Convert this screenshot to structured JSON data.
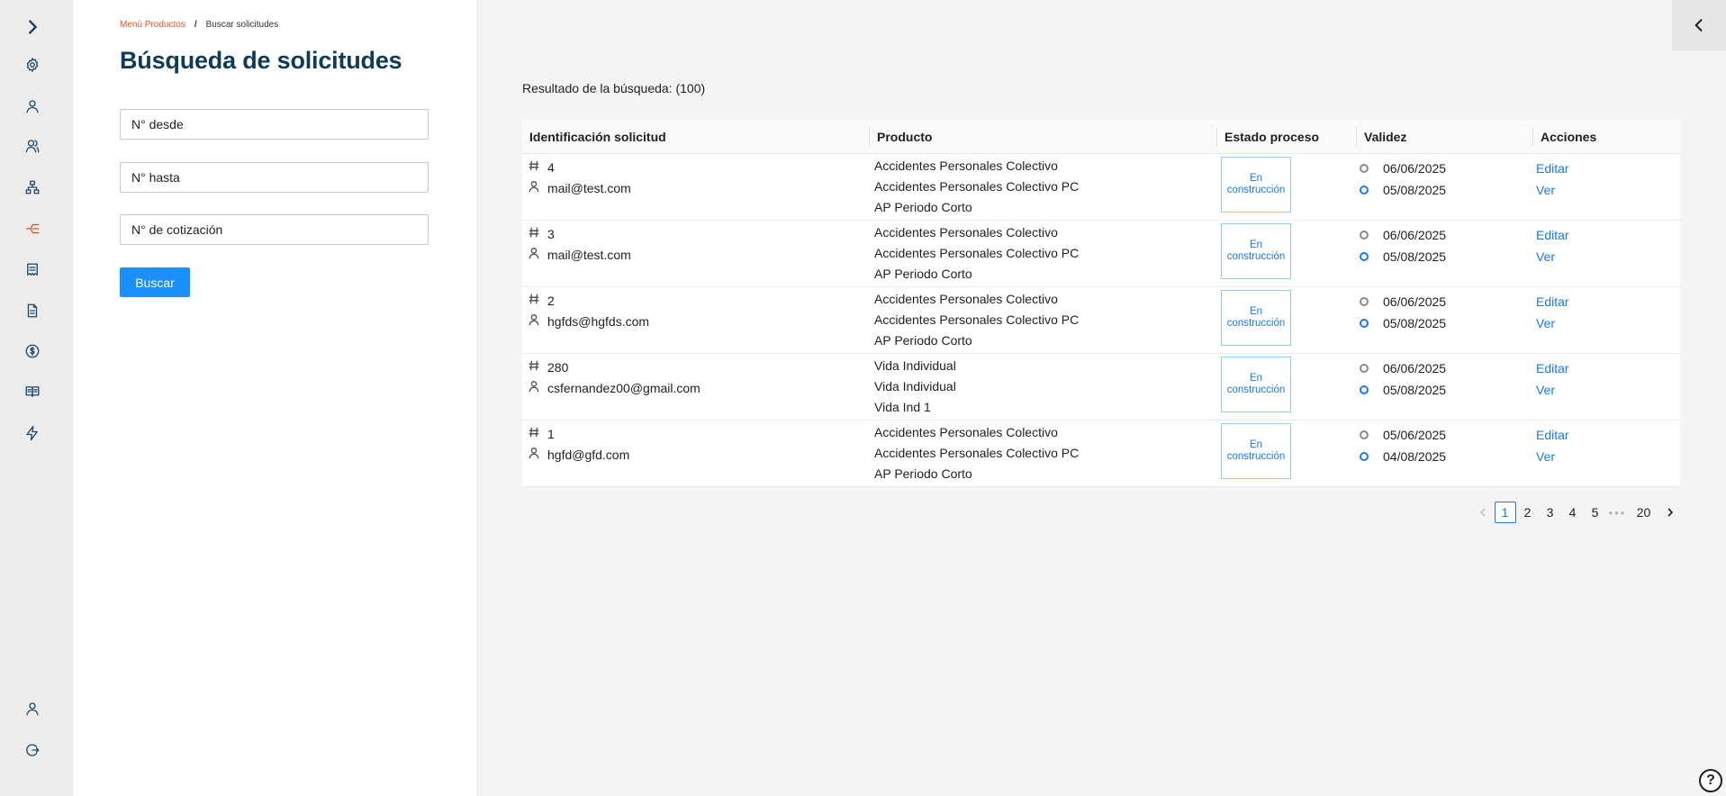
{
  "breadcrumb": {
    "parent": "Menú Productos",
    "separator": "/",
    "current": "Buscar solicitudes"
  },
  "page_title": "Búsqueda de solicitudes",
  "form": {
    "desde_placeholder": "N° desde",
    "hasta_placeholder": "N° hasta",
    "cotizacion_placeholder": "N° de cotización",
    "search_label": "Buscar"
  },
  "result_label": "Resultado de la búsqueda: (100)",
  "table": {
    "columns": [
      "Identificación solicitud",
      "Producto",
      "Estado proceso",
      "Validez",
      "Acciones"
    ],
    "rows": [
      {
        "id": "4",
        "email": "mail@test.com",
        "product_line1": "Accidentes Personales Colectivo",
        "product_line2": "Accidentes Personales Colectivo PC",
        "product_line3": "AP Periodo Corto",
        "status_line1": "En",
        "status_line2": "construcción",
        "valid_from": "06/06/2025",
        "valid_to": "05/08/2025",
        "edit_label": "Editar",
        "view_label": "Ver"
      },
      {
        "id": "3",
        "email": "mail@test.com",
        "product_line1": "Accidentes Personales Colectivo",
        "product_line2": "Accidentes Personales Colectivo PC",
        "product_line3": "AP Periodo Corto",
        "status_line1": "En",
        "status_line2": "construcción",
        "valid_from": "06/06/2025",
        "valid_to": "05/08/2025",
        "edit_label": "Editar",
        "view_label": "Ver"
      },
      {
        "id": "2",
        "email": "hgfds@hgfds.com",
        "product_line1": "Accidentes Personales Colectivo",
        "product_line2": "Accidentes Personales Colectivo PC",
        "product_line3": "AP Periodo Corto",
        "status_line1": "En",
        "status_line2": "construcción",
        "valid_from": "06/06/2025",
        "valid_to": "05/08/2025",
        "edit_label": "Editar",
        "view_label": "Ver"
      },
      {
        "id": "280",
        "email": "csfernandez00@gmail.com",
        "product_line1": "Vida Individual",
        "product_line2": "Vida Individual",
        "product_line3": "Vida Ind 1",
        "status_line1": "En",
        "status_line2": "construcción",
        "valid_from": "06/06/2025",
        "valid_to": "05/08/2025",
        "edit_label": "Editar",
        "view_label": "Ver"
      },
      {
        "id": "1",
        "email": "hgfd@gfd.com",
        "product_line1": "Accidentes Personales Colectivo",
        "product_line2": "Accidentes Personales Colectivo PC",
        "product_line3": "AP Periodo Corto",
        "status_line1": "En",
        "status_line2": "construcción",
        "valid_from": "05/06/2025",
        "valid_to": "04/08/2025",
        "edit_label": "Editar",
        "view_label": "Ver"
      }
    ]
  },
  "pagination": {
    "pages": [
      "1",
      "2",
      "3",
      "4",
      "5"
    ],
    "ellipsis": "•••",
    "last": "20",
    "current": "1"
  },
  "icons": {
    "sidebar": [
      "chevron-right-icon",
      "gear-icon",
      "user-icon",
      "users-icon",
      "hierarchy-icon",
      "flow-icon",
      "receipt-icon",
      "document-icon",
      "dollar-icon",
      "book-icon",
      "lightning-icon",
      "user-icon",
      "logout-icon"
    ],
    "active_sidebar_item": "flow-icon",
    "collapse": "chevron-left-icon",
    "help": "help-icon",
    "help_glyph": "?"
  },
  "colors": {
    "primary": "#1890ff",
    "link": "#1677ff",
    "title": "#0e3a5c",
    "accent": "#e0522a",
    "sidebar_icon": "#1d4a6b"
  }
}
